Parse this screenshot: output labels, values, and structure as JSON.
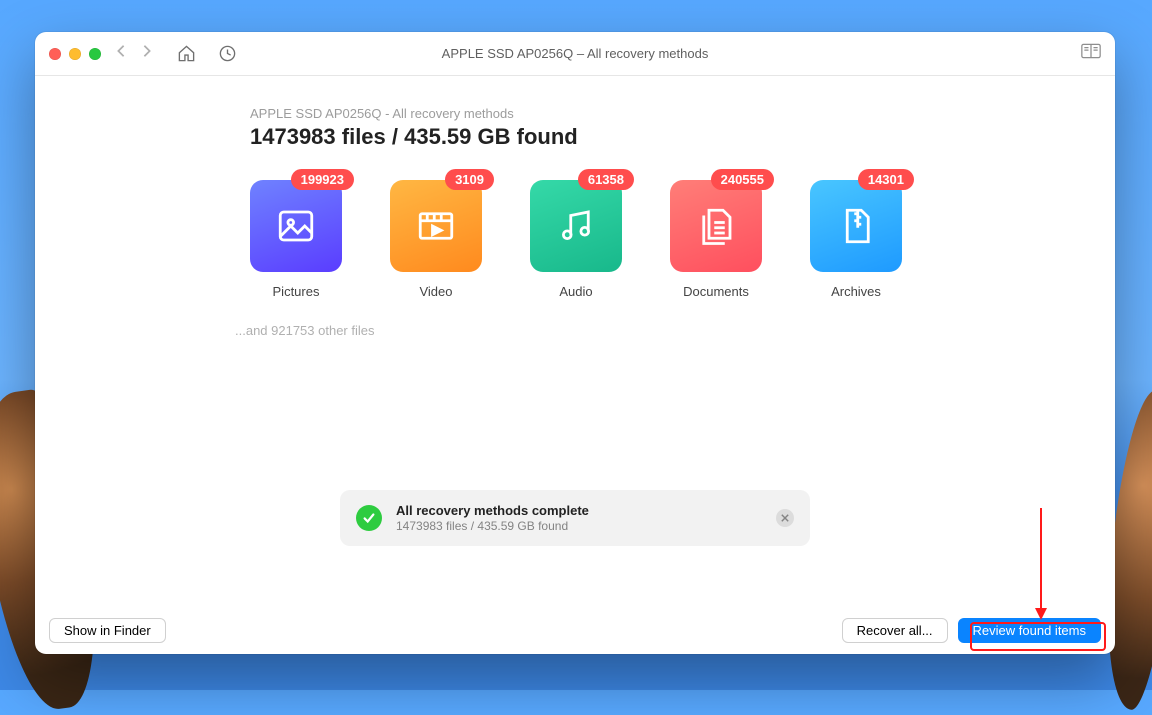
{
  "window": {
    "title": "APPLE SSD AP0256Q – All recovery methods"
  },
  "breadcrumb": "APPLE SSD AP0256Q - All recovery methods",
  "summary": "1473983 files / 435.59 GB found",
  "categories": {
    "pictures": {
      "label": "Pictures",
      "count": "199923"
    },
    "video": {
      "label": "Video",
      "count": "3109"
    },
    "audio": {
      "label": "Audio",
      "count": "61358"
    },
    "documents": {
      "label": "Documents",
      "count": "240555"
    },
    "archives": {
      "label": "Archives",
      "count": "14301"
    }
  },
  "other_files": "...and 921753 other files",
  "status": {
    "title": "All recovery methods complete",
    "subtitle": "1473983 files / 435.59 GB found"
  },
  "buttons": {
    "show_in_finder": "Show in Finder",
    "recover_all": "Recover all...",
    "review": "Review found items"
  }
}
